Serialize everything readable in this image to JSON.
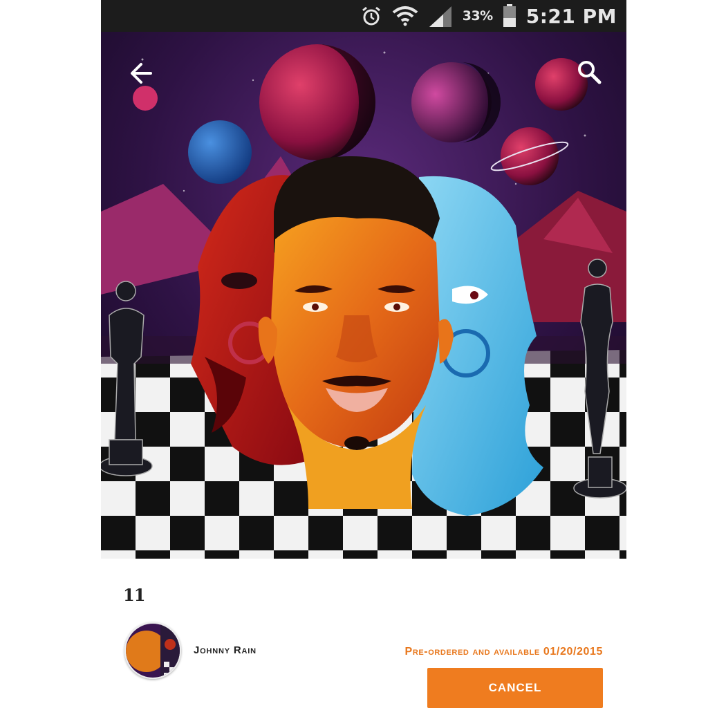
{
  "status_bar": {
    "battery_percent": "33%",
    "time": "5:21 PM",
    "icons": [
      "alarm-icon",
      "wifi-icon",
      "signal-icon",
      "battery-icon"
    ]
  },
  "toolbar": {
    "back_icon": "arrow-left-icon",
    "search_icon": "search-icon"
  },
  "album": {
    "title": "11",
    "artist": "Johnny Rain",
    "availability": "Pre-ordered and available 01/20/2015",
    "cancel_label": "CANCEL"
  },
  "colors": {
    "accent": "#ef7c1f",
    "availability_text": "#e8771c",
    "status_bar_bg": "#1c1c1c"
  }
}
